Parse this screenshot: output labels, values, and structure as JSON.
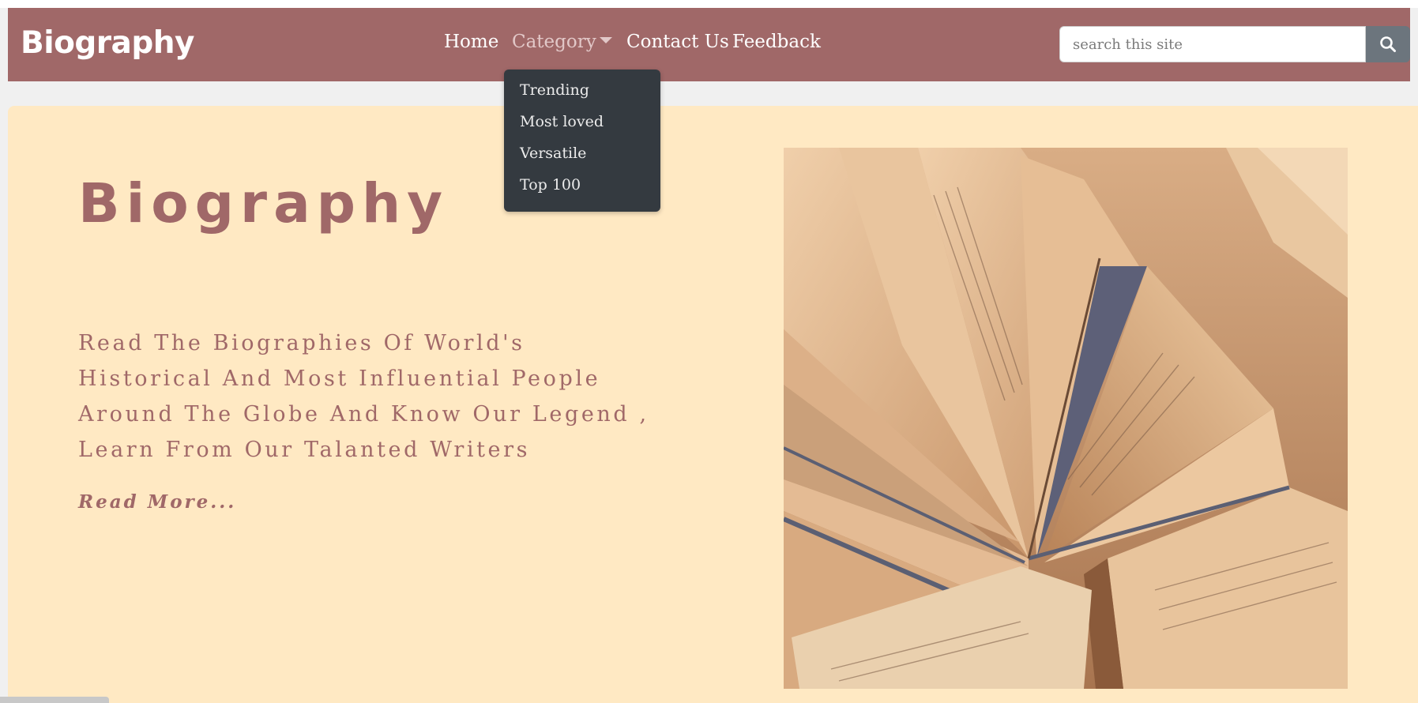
{
  "navbar": {
    "brand": "Biography",
    "links": {
      "home": "Home",
      "category": "Category",
      "contact": "Contact Us",
      "feedback": "Feedback"
    },
    "search": {
      "placeholder": "search this site",
      "icon": "search-icon"
    },
    "background_color": "#a06868"
  },
  "dropdown": {
    "items": [
      "Trending",
      "Most loved",
      "Versatile",
      "Top 100"
    ],
    "background_color": "#343a40"
  },
  "hero": {
    "title": "Biography",
    "lines": [
      "Read The Biographies Of World's",
      "Historical And Most Influential People",
      "Around The Globe And Know Our Legend ,",
      "Learn From Our Talanted Writers"
    ],
    "read_more": "Read More...",
    "image": "open-books-photo",
    "background_color": "#ffe9c3",
    "accent_color": "#a06868"
  }
}
